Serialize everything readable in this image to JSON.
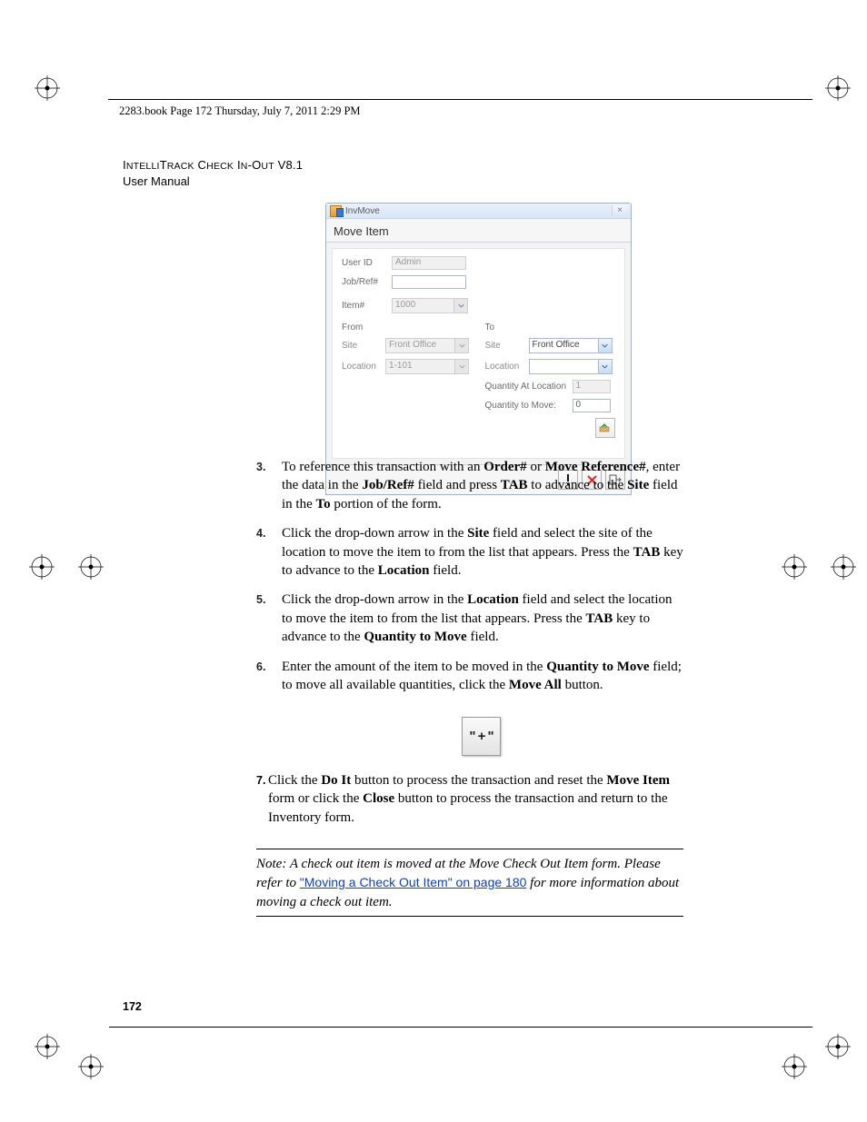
{
  "header_text": "2283.book  Page 172  Thursday, July 7, 2011  2:29 PM",
  "doc_title_line1_a": "I",
  "doc_title_line1_b": "NTELLI",
  "doc_title_line1_c": "T",
  "doc_title_line1_d": "RACK",
  "doc_title_line1_e": " C",
  "doc_title_line1_f": "HECK",
  "doc_title_line1_g": " I",
  "doc_title_line1_h": "N",
  "doc_title_line1_i": "-O",
  "doc_title_line1_j": "UT",
  "doc_title_line1_k": " V8.1",
  "doc_title_line2": "User Manual",
  "app": {
    "window_title": "InvMove",
    "form_title": "Move Item",
    "labels": {
      "userid": "User ID",
      "jobref": "Job/Ref#",
      "item": "Item#",
      "from": "From",
      "to": "To",
      "site": "Site",
      "location": "Location",
      "qty_at_loc": "Quantity At Location",
      "qty_to_move": "Quantity to Move:"
    },
    "values": {
      "userid": "Admin",
      "jobref": "",
      "item": "1000",
      "from_site": "Front Office",
      "from_location": "1-101",
      "to_site": "Front Office",
      "to_location": "",
      "qty_at_loc": "1",
      "qty_to_move": "0"
    }
  },
  "steps": {
    "s3": {
      "num": "3.",
      "t1": "To reference this transaction with an ",
      "b1": "Order#",
      "t2": " or ",
      "b2": "Move Reference#",
      "t3": ", enter the data in the ",
      "b3": "Job/Ref#",
      "t4": " field and press ",
      "b4": "TAB",
      "t5": " to advance to the ",
      "b5": "Site",
      "t6": " field in the ",
      "b6": "To",
      "t7": " portion of the form."
    },
    "s4": {
      "num": "4.",
      "t1": "Click the drop-down arrow in the ",
      "b1": "Site",
      "t2": " field and select the site of the location to move the item to from the list that appears. Press the ",
      "b2": "TAB",
      "t3": " key to advance to the ",
      "b3": "Location",
      "t4": " field."
    },
    "s5": {
      "num": "5.",
      "t1": "Click the drop-down arrow in the ",
      "b1": "Location",
      "t2": " field and select the location to move the item to from the list that appears. Press the ",
      "b2": "TAB",
      "t3": " key to advance to the ",
      "b3": "Quantity to Move",
      "t4": " field."
    },
    "s6": {
      "num": "6.",
      "t1": "Enter the amount of the item to be moved in the ",
      "b1": "Quantity to Move",
      "t2": " field; to move all available quantities, click the ",
      "b2": "Move All",
      "t3": " button."
    },
    "s7": {
      "num": "7.",
      "t1": "Click the ",
      "b1": "Do It",
      "t2": " button to process the transaction and reset the ",
      "b2": "Move Item",
      "t3": " form or click the ",
      "b3": "Close",
      "t4": " button to process the transaction and return to the Inventory form."
    }
  },
  "plus_button_label": "\" + \"",
  "note": {
    "lead": "Note:   ",
    "t1": "A check out item is moved at the Move Check Out Item form. Please refer to ",
    "link": "\"Moving a Check Out Item\" on page 180",
    "t2": " for more information about moving a check out item."
  },
  "page_number": "172"
}
